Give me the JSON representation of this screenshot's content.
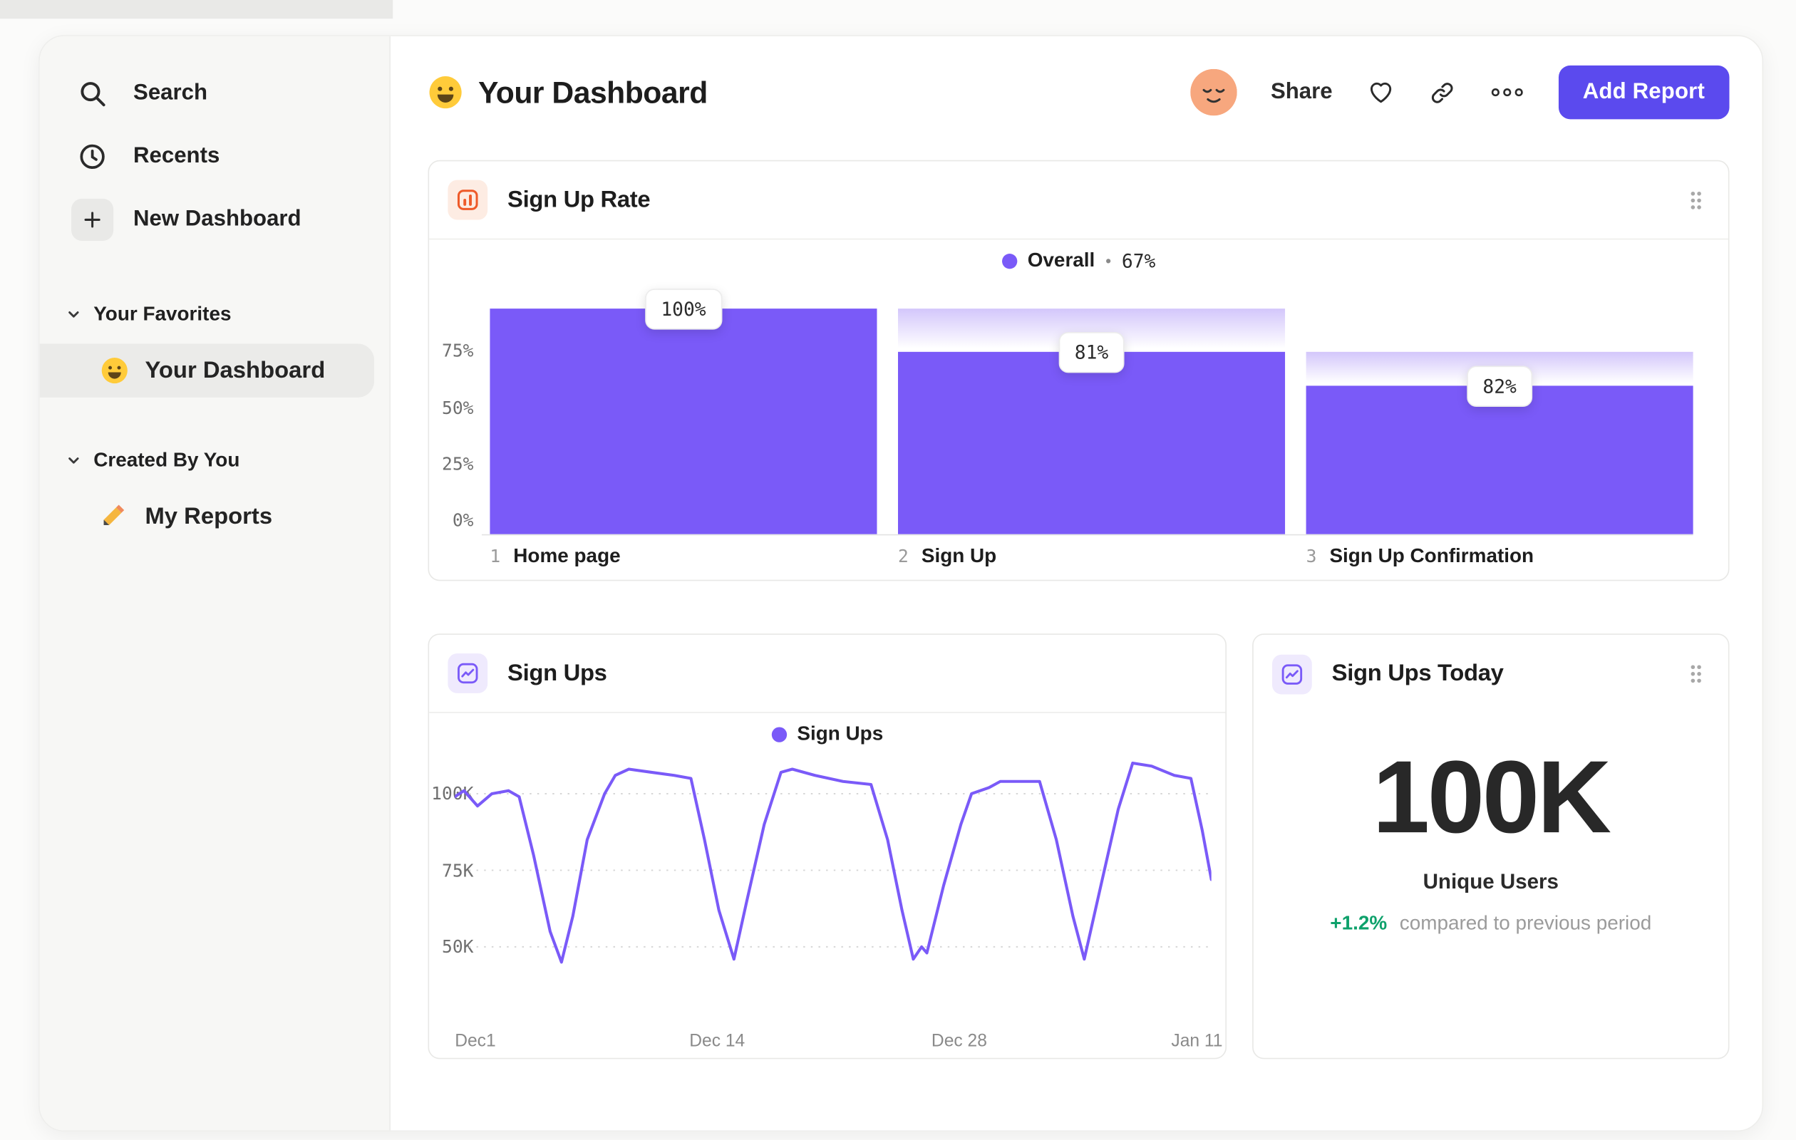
{
  "colors": {
    "purple": "#7A5AF8",
    "button_purple": "#5B4AEE",
    "orange": "#EE5A29",
    "green": "#0EA16B",
    "bar_ghost_top": "#D3C6FB"
  },
  "sidebar": {
    "nav": [
      {
        "label": "Search",
        "icon": "search"
      },
      {
        "label": "Recents",
        "icon": "clock"
      },
      {
        "label": "New Dashboard",
        "icon": "plus"
      }
    ],
    "sections": [
      {
        "title": "Your Favorites",
        "items": [
          {
            "label": "Your Dashboard",
            "icon": "smiley",
            "active": true
          }
        ]
      },
      {
        "title": "Created By You",
        "items": [
          {
            "label": "My Reports",
            "icon": "pencil",
            "active": false
          }
        ]
      }
    ]
  },
  "header": {
    "title": "Your Dashboard",
    "share_label": "Share",
    "add_report_label": "Add Report"
  },
  "cards": {
    "signup_rate": {
      "title": "Sign Up Rate",
      "legend_label": "Overall",
      "legend_sep": "•",
      "legend_value": "67%"
    },
    "signups": {
      "title": "Sign Ups",
      "legend_label": "Sign Ups"
    },
    "signups_today": {
      "title": "Sign Ups Today",
      "value": "100K",
      "subtitle": "Unique Users",
      "delta": "+1.2%",
      "delta_description": "compared to previous period"
    }
  },
  "chart_data": [
    {
      "type": "bar",
      "title": "Sign Up Rate",
      "legend": "Overall • 67%",
      "ylim": [
        0,
        100
      ],
      "y_ticks": [
        {
          "label": "75%",
          "value": 75
        },
        {
          "label": "50%",
          "value": 50
        },
        {
          "label": "25%",
          "value": 25
        },
        {
          "label": "0%",
          "value": 0
        }
      ],
      "bars": [
        {
          "step": "1",
          "label": "Home page",
          "value_label": "100%",
          "conversion_pct": 100,
          "fill_pct": 100,
          "total_pct": 100
        },
        {
          "step": "2",
          "label": "Sign Up",
          "value_label": "81%",
          "conversion_pct": 81,
          "fill_pct": 81,
          "total_pct": 100
        },
        {
          "step": "3",
          "label": "Sign Up Confirmation",
          "value_label": "82%",
          "conversion_pct": 82,
          "fill_pct": 66,
          "total_pct": 81
        }
      ]
    },
    {
      "type": "line",
      "title": "Sign Ups",
      "legend": "Sign Ups",
      "unit": "K",
      "ylim": [
        40,
        115
      ],
      "y_ticks": [
        {
          "label": "100K",
          "value": 100
        },
        {
          "label": "75K",
          "value": 75
        },
        {
          "label": "50K",
          "value": 50
        }
      ],
      "x_ticks": [
        {
          "label": "Dec1",
          "frac": 0
        },
        {
          "label": "Dec 14",
          "frac": 0.31
        },
        {
          "label": "Dec 28",
          "frac": 0.63
        },
        {
          "label": "Jan 11",
          "frac": 0.947
        }
      ],
      "points": [
        [
          0,
          99
        ],
        [
          0.012,
          101
        ],
        [
          0.03,
          96
        ],
        [
          0.049,
          100
        ],
        [
          0.071,
          101
        ],
        [
          0.085,
          99
        ],
        [
          0.104,
          80
        ],
        [
          0.126,
          55
        ],
        [
          0.141,
          45
        ],
        [
          0.156,
          60
        ],
        [
          0.175,
          85
        ],
        [
          0.198,
          100
        ],
        [
          0.212,
          106
        ],
        [
          0.23,
          108
        ],
        [
          0.26,
          107
        ],
        [
          0.29,
          106
        ],
        [
          0.312,
          105
        ],
        [
          0.33,
          85
        ],
        [
          0.349,
          62
        ],
        [
          0.369,
          46
        ],
        [
          0.386,
          65
        ],
        [
          0.409,
          90
        ],
        [
          0.431,
          107
        ],
        [
          0.446,
          108
        ],
        [
          0.476,
          106
        ],
        [
          0.513,
          104
        ],
        [
          0.55,
          103
        ],
        [
          0.572,
          85
        ],
        [
          0.591,
          62
        ],
        [
          0.606,
          46
        ],
        [
          0.617,
          50
        ],
        [
          0.624,
          48
        ],
        [
          0.646,
          70
        ],
        [
          0.669,
          90
        ],
        [
          0.683,
          100
        ],
        [
          0.706,
          102
        ],
        [
          0.721,
          104
        ],
        [
          0.773,
          104
        ],
        [
          0.795,
          85
        ],
        [
          0.817,
          60
        ],
        [
          0.832,
          46
        ],
        [
          0.854,
          70
        ],
        [
          0.877,
          95
        ],
        [
          0.896,
          110
        ],
        [
          0.921,
          109
        ],
        [
          0.951,
          106
        ],
        [
          0.973,
          105
        ],
        [
          0.988,
          88
        ],
        [
          1,
          72
        ]
      ]
    }
  ]
}
